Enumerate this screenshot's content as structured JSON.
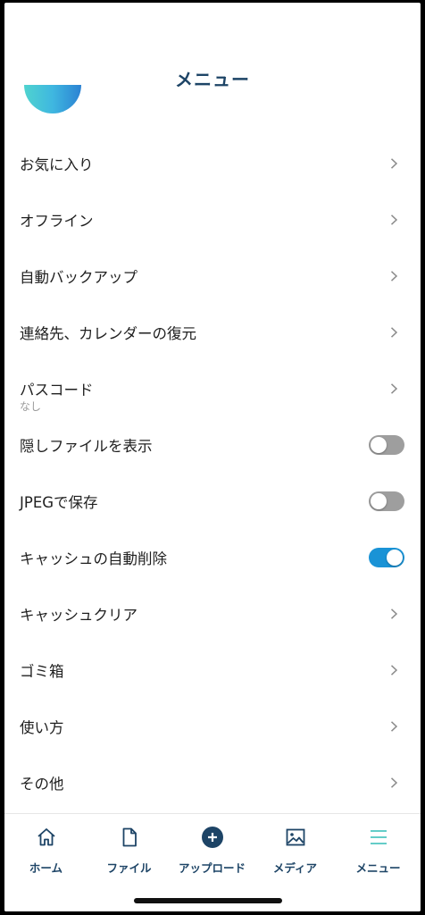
{
  "header": {
    "title": "メニュー"
  },
  "menu": [
    {
      "label": "お気に入り",
      "control": "chevron"
    },
    {
      "label": "オフライン",
      "control": "chevron"
    },
    {
      "label": "自動バックアップ",
      "control": "chevron"
    },
    {
      "label": "連絡先、カレンダーの復元",
      "control": "chevron"
    },
    {
      "label": "パスコード",
      "sub": "なし",
      "control": "chevron"
    },
    {
      "label": "隠しファイルを表示",
      "control": "toggle",
      "on": false
    },
    {
      "label": "JPEGで保存",
      "control": "toggle",
      "on": false
    },
    {
      "label": "キャッシュの自動削除",
      "control": "toggle",
      "on": true
    },
    {
      "label": "キャッシュクリア",
      "control": "chevron"
    },
    {
      "label": "ゴミ箱",
      "control": "chevron"
    },
    {
      "label": "使い方",
      "control": "chevron"
    },
    {
      "label": "その他",
      "control": "chevron"
    }
  ],
  "tabbar": {
    "home": "ホーム",
    "file": "ファイル",
    "upload": "アップロード",
    "media": "メディア",
    "menu": "メニュー"
  },
  "colors": {
    "accent": "#1d4466",
    "toggle_on": "#1a93d6",
    "toggle_off": "#9e9e9e",
    "menu_tab_active": "#4fc6c0"
  }
}
